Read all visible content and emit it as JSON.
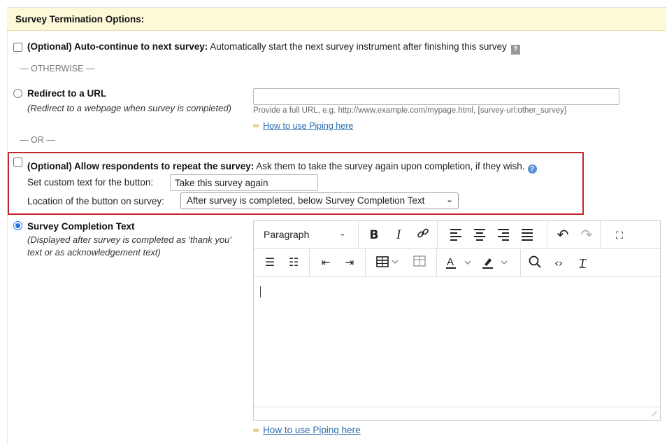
{
  "header": {
    "title": "Survey Termination Options:"
  },
  "auto_continue": {
    "label_bold": "(Optional) Auto-continue to next survey:",
    "label_rest": " Automatically start the next survey instrument after finishing this survey",
    "help": "?"
  },
  "sep_otherwise": "— OTHERWISE —",
  "redirect": {
    "label": "Redirect to a URL",
    "note": "(Redirect to a webpage when survey is completed)",
    "url_value": "",
    "hint": "Provide a full URL, e.g. http://www.example.com/mypage.html, [survey-url:other_survey]",
    "piping_link": "How to use Piping here"
  },
  "sep_or": "— OR —",
  "repeat": {
    "label_bold": "(Optional) Allow respondents to repeat the survey:",
    "label_rest": " Ask them to take the survey again upon completion, if they wish.",
    "button_text_label": "Set custom text for the button:",
    "button_text_value": "Take this survey again",
    "location_label": "Location of the button on survey:",
    "location_value": "After survey is completed, below Survey Completion Text"
  },
  "completion": {
    "label": "Survey Completion Text",
    "note_line1": "(Displayed after survey is completed as 'thank you'",
    "note_line2": "text or as acknowledgement text)",
    "piping_link": "How to use Piping here"
  },
  "editor": {
    "block_format": "Paragraph",
    "toolbar_row1": [
      "bold-icon",
      "italic-icon",
      "link-icon",
      "align-left-icon",
      "align-center-icon",
      "align-right-icon",
      "align-justify-icon",
      "undo-icon",
      "redo-icon",
      "fullscreen-icon"
    ],
    "toolbar_row2": [
      "bullet-list-icon",
      "numbered-list-icon",
      "outdent-icon",
      "indent-icon",
      "table-icon",
      "table-props-icon",
      "text-color-icon",
      "highlight-color-icon",
      "search-icon",
      "source-code-icon",
      "clear-format-icon"
    ],
    "content": ""
  },
  "colors": {
    "header_bg": "#fdf9d8",
    "highlight_border": "#c1272d",
    "link": "#2a6db0",
    "radio_checked": "#1a73e8"
  }
}
